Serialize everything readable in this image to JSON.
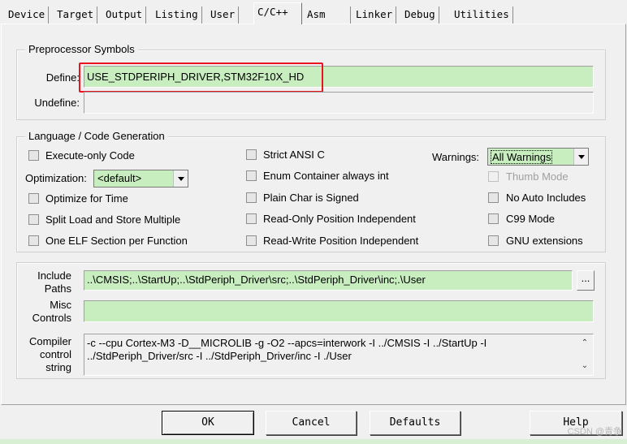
{
  "tabs": [
    {
      "label": "Device"
    },
    {
      "label": "Target"
    },
    {
      "label": "Output"
    },
    {
      "label": "Listing"
    },
    {
      "label": "User"
    },
    {
      "label": "C/C++",
      "active": true
    },
    {
      "label": "Asm"
    },
    {
      "label": "Linker"
    },
    {
      "label": "Debug"
    },
    {
      "label": "Utilities"
    }
  ],
  "preprocessor": {
    "title": "Preprocessor Symbols",
    "define_label": "Define:",
    "define_value": "USE_STDPERIPH_DRIVER,STM32F10X_HD",
    "undefine_label": "Undefine:",
    "undefine_value": ""
  },
  "language": {
    "title": "Language / Code Generation",
    "execute_only": "Execute-only Code",
    "optimization_label": "Optimization:",
    "optimization_value": "<default>",
    "optimize_time": "Optimize for Time",
    "split_load": "Split Load and Store Multiple",
    "one_elf": "One ELF Section per Function",
    "strict_ansi": "Strict ANSI C",
    "enum_container": "Enum Container always int",
    "plain_char": "Plain Char is Signed",
    "ro_position": "Read-Only Position Independent",
    "rw_position": "Read-Write Position Independent",
    "warnings_label": "Warnings:",
    "warnings_value": "All Warnings",
    "thumb_mode": "Thumb Mode",
    "no_auto_includes": "No Auto Includes",
    "c99_mode": "C99 Mode",
    "gnu_extensions": "GNU extensions"
  },
  "paths": {
    "include_label_1": "Include",
    "include_label_2": "Paths",
    "include_value": "..\\CMSIS;..\\StartUp;..\\StdPeriph_Driver\\src;..\\StdPeriph_Driver\\inc;.\\User",
    "browse_label": "...",
    "misc_label_1": "Misc",
    "misc_label_2": "Controls",
    "misc_value": "",
    "compiler_label_1": "Compiler",
    "compiler_label_2": "control",
    "compiler_label_3": "string",
    "compiler_value": "-c --cpu Cortex-M3 -D__MICROLIB -g -O2 --apcs=interwork -I ../CMSIS -I ../StartUp -I ../StdPeriph_Driver/src -I ../StdPeriph_Driver/inc -I ./User"
  },
  "buttons": {
    "ok": "OK",
    "cancel": "Cancel",
    "defaults": "Defaults",
    "help": "Help"
  },
  "watermark": "CSDN @青争"
}
